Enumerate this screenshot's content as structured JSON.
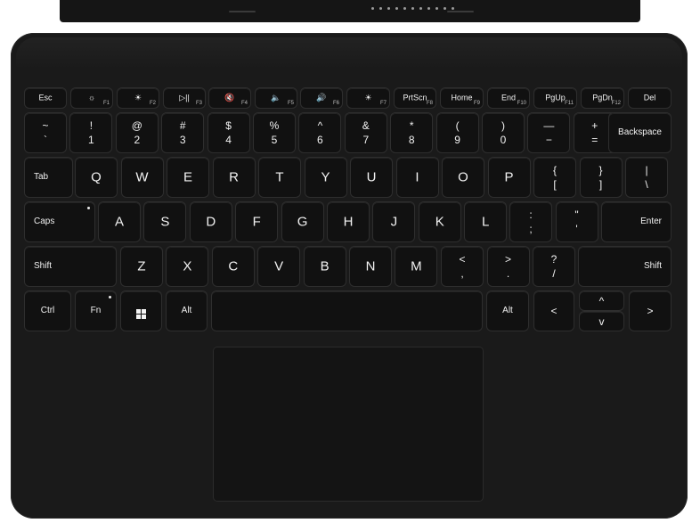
{
  "function_row": [
    {
      "id": "esc",
      "label": "Esc",
      "fn": ""
    },
    {
      "id": "f1",
      "label": "☼",
      "fn": "F1"
    },
    {
      "id": "f2",
      "label": "☀",
      "fn": "F2"
    },
    {
      "id": "f3",
      "label": "▷||",
      "fn": "F3"
    },
    {
      "id": "f4",
      "label": "🔇",
      "fn": "F4"
    },
    {
      "id": "f5",
      "label": "🔈",
      "fn": "F5"
    },
    {
      "id": "f6",
      "label": "🔊",
      "fn": "F6"
    },
    {
      "id": "f7",
      "label": "☀",
      "fn": "F7"
    },
    {
      "id": "f8",
      "label": "PrtScn",
      "fn": "F8"
    },
    {
      "id": "f9",
      "label": "Home",
      "fn": "F9"
    },
    {
      "id": "f10",
      "label": "End",
      "fn": "F10"
    },
    {
      "id": "f11",
      "label": "PgUp",
      "fn": "F11"
    },
    {
      "id": "f12",
      "label": "PgDn",
      "fn": "F12"
    },
    {
      "id": "del",
      "label": "Del",
      "fn": ""
    }
  ],
  "number_row": [
    {
      "up": "~",
      "down": "`"
    },
    {
      "up": "!",
      "down": "1"
    },
    {
      "up": "@",
      "down": "2"
    },
    {
      "up": "#",
      "down": "3"
    },
    {
      "up": "$",
      "down": "4"
    },
    {
      "up": "%",
      "down": "5"
    },
    {
      "up": "^",
      "down": "6"
    },
    {
      "up": "&",
      "down": "7"
    },
    {
      "up": "*",
      "down": "8"
    },
    {
      "up": "(",
      "down": "9"
    },
    {
      "up": ")",
      "down": "0"
    },
    {
      "up": "—",
      "down": "−"
    },
    {
      "up": "+",
      "down": "="
    }
  ],
  "backspace": "Backspace",
  "tab": "Tab",
  "qwerty": [
    "Q",
    "W",
    "E",
    "R",
    "T",
    "Y",
    "U",
    "I",
    "O",
    "P"
  ],
  "qwerty_symbols": [
    {
      "up": "{",
      "down": "["
    },
    {
      "up": "}",
      "down": "]"
    },
    {
      "up": "|",
      "down": "\\"
    }
  ],
  "caps": "Caps",
  "home_row": [
    "A",
    "S",
    "D",
    "F",
    "G",
    "H",
    "J",
    "K",
    "L"
  ],
  "home_symbols": [
    {
      "up": ":",
      "down": ";"
    },
    {
      "up": "\"",
      "down": "'"
    }
  ],
  "enter": "Enter",
  "shift_left": "Shift",
  "bottom_row": [
    "Z",
    "X",
    "C",
    "V",
    "B",
    "N",
    "M"
  ],
  "bottom_symbols": [
    {
      "up": "<",
      "down": ","
    },
    {
      "up": ">",
      "down": "."
    },
    {
      "up": "?",
      "down": "/"
    }
  ],
  "shift_right": "Shift",
  "ctrl": "Ctrl",
  "fn": "Fn",
  "alt_left": "Alt",
  "alt_right": "Alt",
  "arrows": {
    "left": "<",
    "up": "^",
    "down": "v",
    "right": ">"
  }
}
